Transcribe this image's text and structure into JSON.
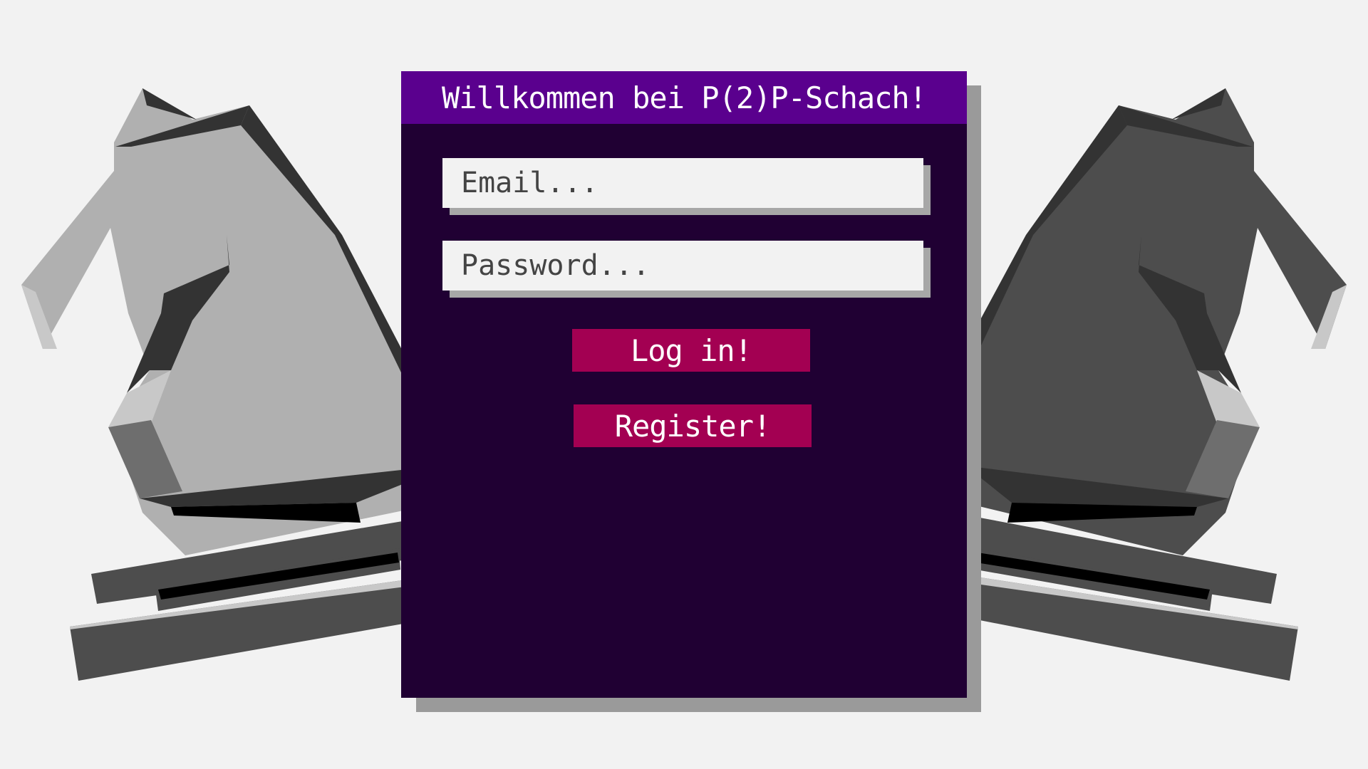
{
  "header": {
    "title": "Willkommen bei P(2)P-Schach!"
  },
  "form": {
    "email_placeholder": "Email...",
    "email_value": "",
    "password_placeholder": "Password...",
    "password_value": ""
  },
  "buttons": {
    "login_label": "Log in!",
    "register_label": "Register!"
  },
  "decor": {
    "left_piece": "white-knight-icon",
    "right_piece": "black-knight-icon"
  },
  "colors": {
    "background": "#f2f2f2",
    "panel": "#200033",
    "header": "#5a008e",
    "button": "#a30052"
  }
}
